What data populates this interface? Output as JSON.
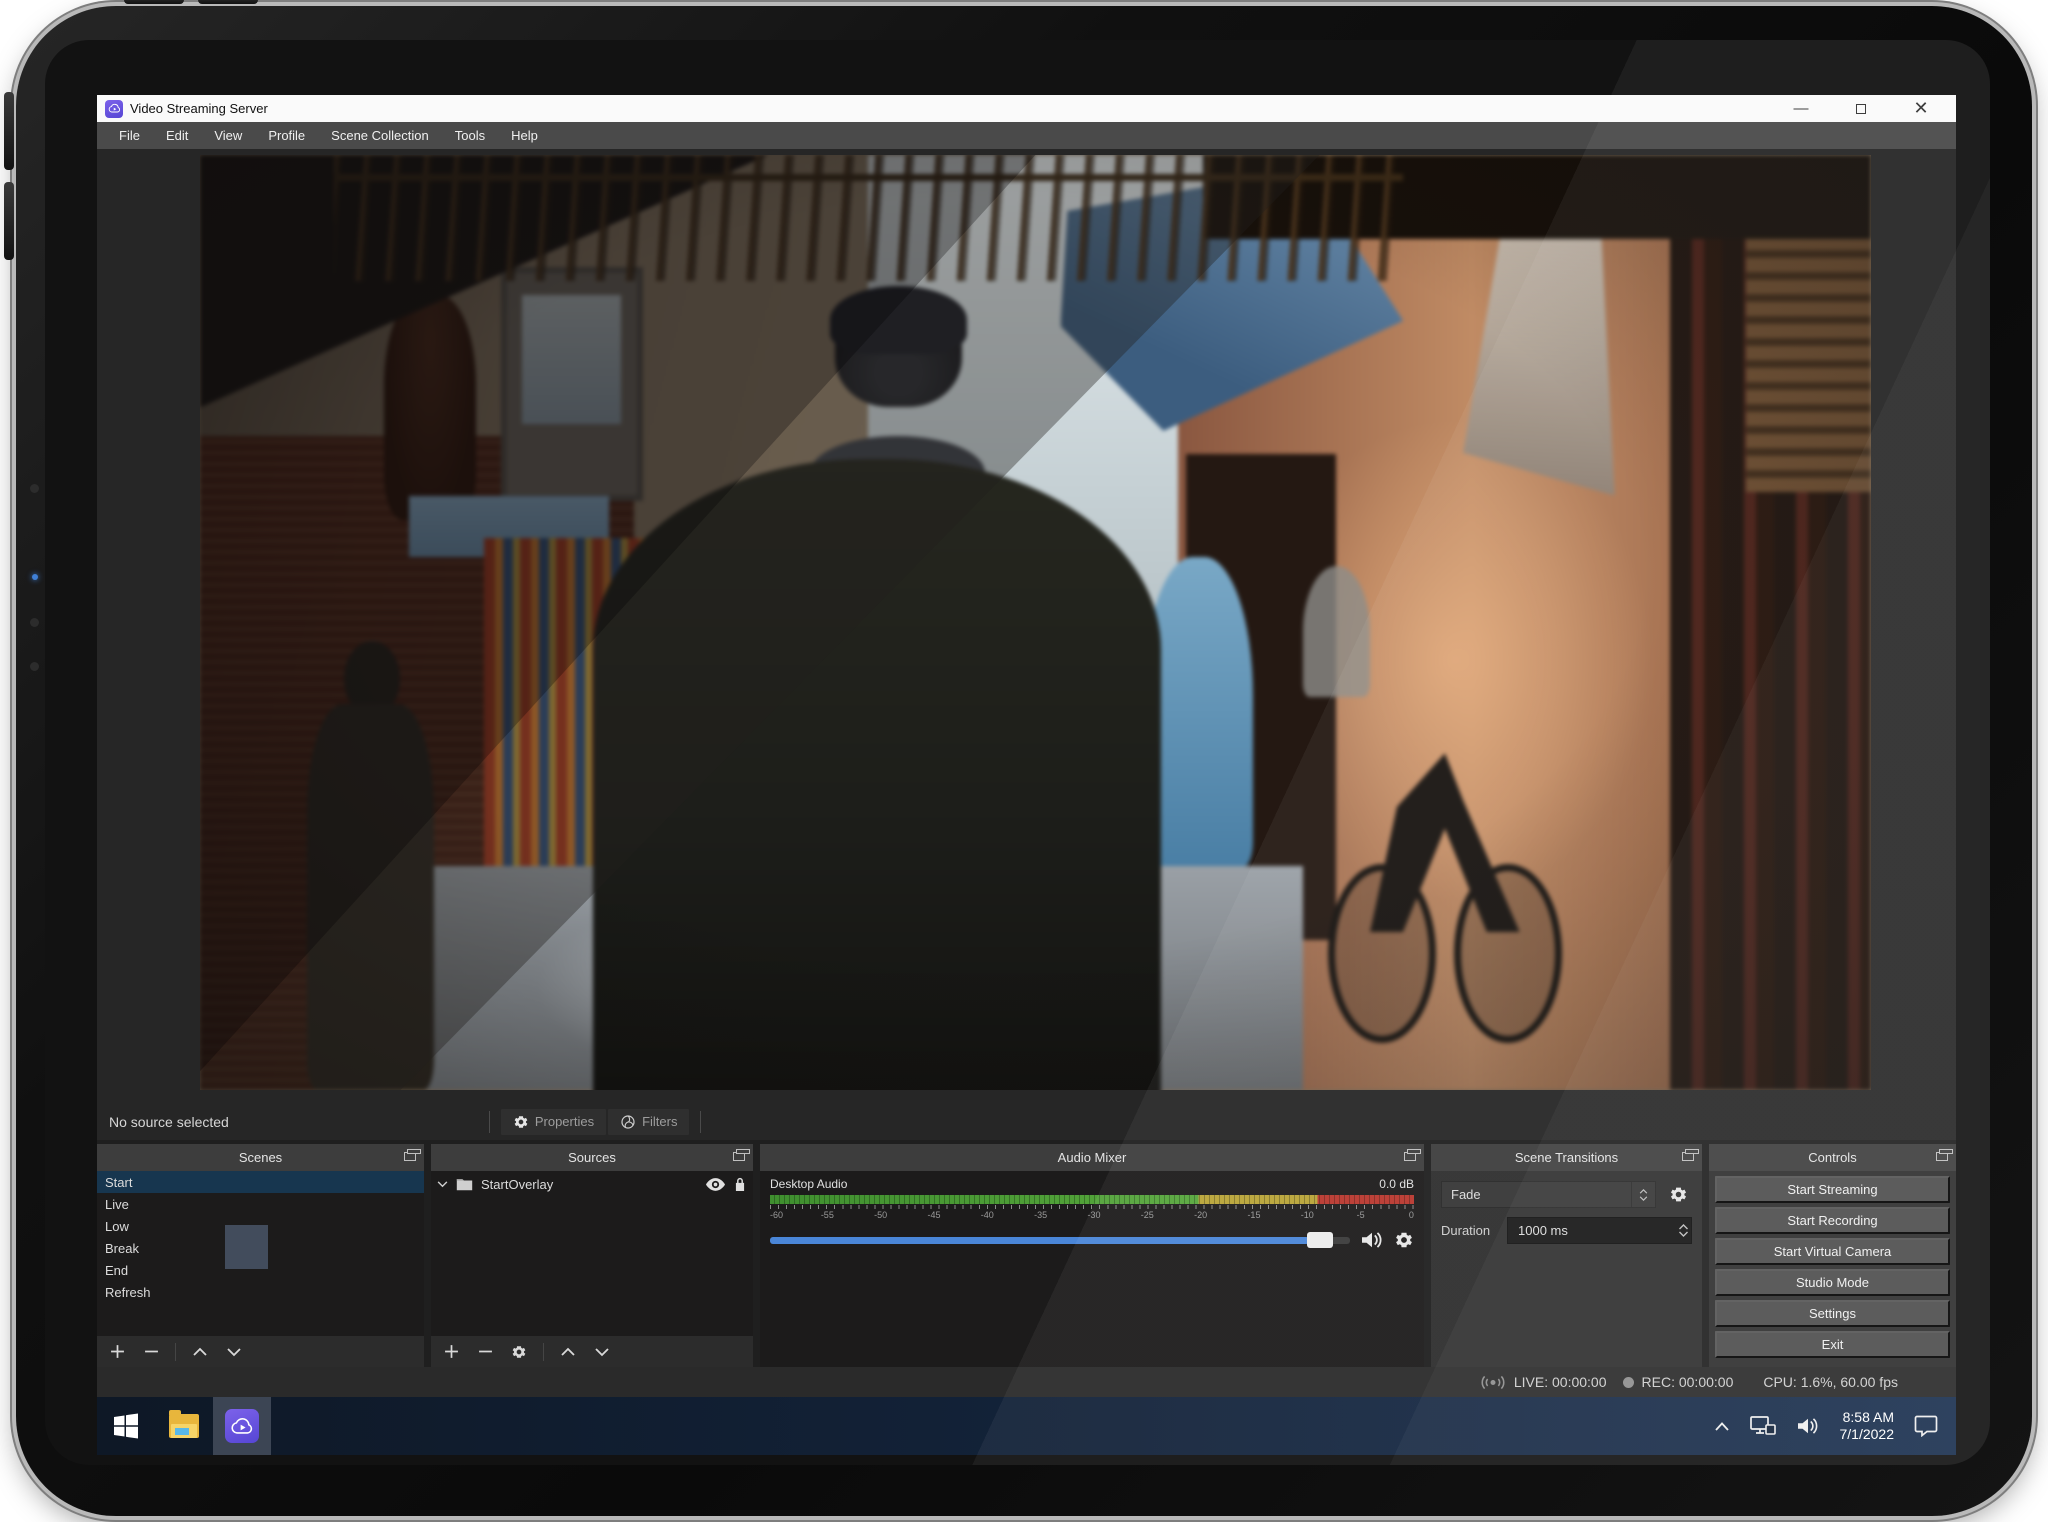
{
  "device": {
    "type": "tablet",
    "frame_color": "#0d0d0d",
    "rim_color": "#b9b9b9"
  },
  "window": {
    "title": "Video Streaming Server",
    "menu": [
      "File",
      "Edit",
      "View",
      "Profile",
      "Scene Collection",
      "Tools",
      "Help"
    ]
  },
  "preview": {
    "description": "market street scene with man walking away from camera"
  },
  "source_toolbar": {
    "status": "No source selected",
    "properties_label": "Properties",
    "filters_label": "Filters"
  },
  "panels": {
    "scenes": {
      "title": "Scenes",
      "items": [
        "Start",
        "Live",
        "Low",
        "Break",
        "End",
        "Refresh"
      ],
      "selected": "Start"
    },
    "sources": {
      "title": "Sources",
      "items": [
        "StartOverlay"
      ]
    },
    "audio_mixer": {
      "title": "Audio Mixer",
      "channel_name": "Desktop Audio",
      "level_label": "0.0 dB",
      "scale_ticks": [
        "-60",
        "-55",
        "-50",
        "-45",
        "-40",
        "-35",
        "-30",
        "-25",
        "-20",
        "-15",
        "-10",
        "-5",
        "0"
      ],
      "meter": {
        "green_until_db": -20,
        "yellow_until_db": -9,
        "max_db": 0
      },
      "volume_slider_pct": 93
    },
    "scene_transitions": {
      "title": "Scene Transitions",
      "transition_value": "Fade",
      "duration_label": "Duration",
      "duration_value": "1000 ms"
    },
    "controls": {
      "title": "Controls",
      "buttons": [
        "Start Streaming",
        "Start Recording",
        "Start Virtual Camera",
        "Studio Mode",
        "Settings",
        "Exit"
      ]
    }
  },
  "status_bar": {
    "live": "LIVE: 00:00:00",
    "rec": "REC: 00:00:00",
    "cpu": "CPU: 1.6%, 60.00 fps"
  },
  "taskbar": {
    "clock": {
      "time": "8:58 AM",
      "date": "7/1/2022"
    }
  },
  "colors": {
    "selection_blue": "#17364f",
    "titlebar": "#fafafa",
    "menubar": "#4a4a4a",
    "panel_header": "#3d3d3d",
    "dock_bg": "#1f1f1f",
    "slider_blue": "#4a86d8",
    "meter_green": "#57a83c",
    "meter_yellow": "#b8a437",
    "meter_red": "#b8372e",
    "taskbar_navy": "#13233a",
    "app_icon_purple": "#6b5be8"
  },
  "icons": {
    "app": "cloud-play",
    "properties": "gear",
    "filters": "filter-swirl",
    "source_visibility": "eye",
    "source_lock": "lock",
    "volume": "speaker",
    "live": "broadcast",
    "taskbar": [
      "windows-start",
      "file-explorer",
      "app-cloud-play"
    ],
    "tray": [
      "chevron-up",
      "network",
      "speaker",
      "clock",
      "action-center"
    ]
  }
}
